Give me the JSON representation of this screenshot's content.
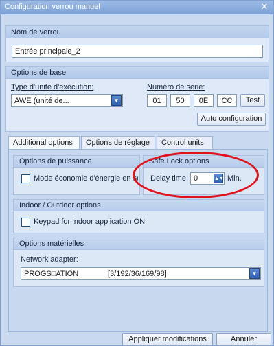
{
  "window": {
    "title": "Configuration verrou manuel",
    "close_glyph": "✕"
  },
  "lock_name": {
    "header": "Nom de verrou",
    "value": "Entrée principale_2"
  },
  "basic_options": {
    "header": "Options de base",
    "execution_unit_label": "Type d'unité d'exécution:",
    "execution_unit_value": "AWE (unité de...",
    "serial_label": "Numéro de série:",
    "serial_parts": [
      "01",
      "50",
      "0E",
      "CC"
    ],
    "test_button": "Test",
    "auto_config_button": "Auto configuration"
  },
  "tabs": [
    {
      "label": "Additional options",
      "active": true
    },
    {
      "label": "Options de réglage",
      "active": false
    },
    {
      "label": "Control units",
      "active": false
    }
  ],
  "power_options": {
    "header": "Options de puissance",
    "checkbox_label": "Mode économie d'énergie en se",
    "checked": false
  },
  "safe_lock": {
    "header": "Safe Lock options",
    "delay_label": "Delay time:",
    "delay_value": "0",
    "unit": "Min."
  },
  "indoor_outdoor": {
    "header": "Indoor / Outdoor options",
    "checkbox_label": "Keypad for indoor application ON",
    "checked": false
  },
  "hardware_options": {
    "header": "Options matérielles",
    "network_label": "Network adapter:",
    "network_name": "PROGS□ATION",
    "network_value": "[3/192/36/169/98]"
  },
  "footer": {
    "apply_button": "Appliquer modifications",
    "cancel_button": "Annuler"
  },
  "colors": {
    "annotation_ellipse": "#e0121b",
    "accent": "#2f5fb0"
  }
}
